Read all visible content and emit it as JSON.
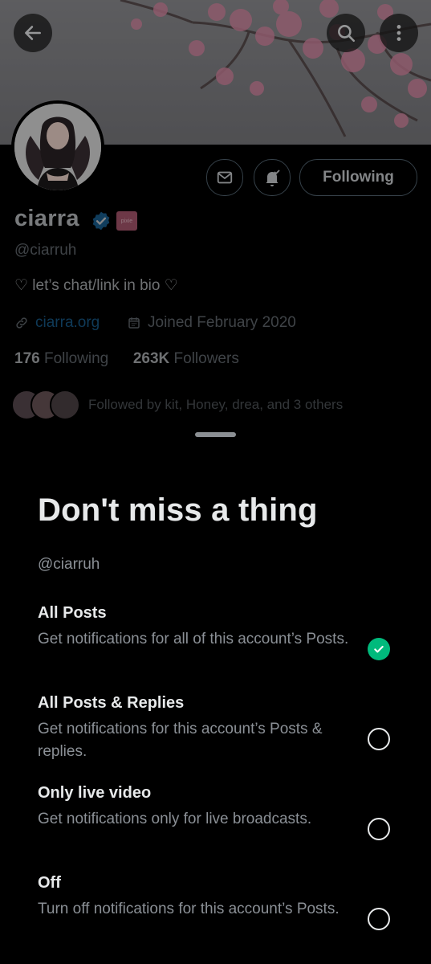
{
  "profile": {
    "name": "ciarra",
    "affiliate_badge_text": "pixie",
    "handle": "@ciarruh",
    "bio": "♡ let’s chat/link in bio ♡",
    "website": "ciarra.org",
    "joined": "Joined February 2020",
    "following_count": "176",
    "following_label": "Following",
    "followers_count": "263K",
    "followers_label": "Followers",
    "followed_by": "Followed by kit, Honey, drea, and 3 others",
    "follow_button_label": "Following"
  },
  "sheet": {
    "title": "Don't miss a thing",
    "handle": "@ciarruh",
    "options": [
      {
        "title": "All Posts",
        "description": "Get notifications for all of this account’s Posts.",
        "selected": true
      },
      {
        "title": "All Posts & Replies",
        "description": "Get notifications for this account’s Posts & replies.",
        "selected": false
      },
      {
        "title": "Only live video",
        "description": "Get notifications only for live broadcasts.",
        "selected": false
      },
      {
        "title": "Off",
        "description": "Turn off notifications for this account’s Posts.",
        "selected": false
      }
    ]
  },
  "colors": {
    "background": "#000000",
    "selected_check": "#00ba7c",
    "link": "#1d9bf0",
    "verified": "#1d9bf0"
  },
  "icons": [
    "back-arrow-icon",
    "search-icon",
    "more-vertical-icon",
    "mail-icon",
    "bell-check-icon",
    "verified-icon",
    "link-icon",
    "calendar-icon",
    "check-icon"
  ]
}
